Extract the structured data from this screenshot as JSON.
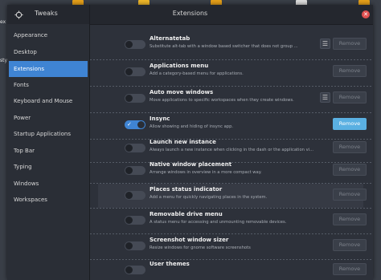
{
  "desktop": {
    "labels": [
      "ex",
      "sty"
    ]
  },
  "window": {
    "app_title": "Tweaks",
    "title": "Extensions",
    "close_glyph": "✕"
  },
  "sidebar": {
    "items": [
      {
        "label": "Appearance",
        "active": false
      },
      {
        "label": "Desktop",
        "active": false
      },
      {
        "label": "Extensions",
        "active": true
      },
      {
        "label": "Fonts",
        "active": false
      },
      {
        "label": "Keyboard and Mouse",
        "active": false
      },
      {
        "label": "Power",
        "active": false
      },
      {
        "label": "Startup Applications",
        "active": false
      },
      {
        "label": "Top Bar",
        "active": false
      },
      {
        "label": "Typing",
        "active": false
      },
      {
        "label": "Windows",
        "active": false
      },
      {
        "label": "Workspaces",
        "active": false
      }
    ]
  },
  "extensions": [
    {
      "title": "Alternatetab",
      "description": "Substitute alt-tab with a window based switcher that does not group ...",
      "enabled": false,
      "has_prefs": true,
      "remove_label": "Remove",
      "remove_active": false
    },
    {
      "title": "Applications menu",
      "description": "Add a category-based menu for applications.",
      "enabled": false,
      "has_prefs": false,
      "remove_label": "Remove",
      "remove_active": false
    },
    {
      "title": "Auto move windows",
      "description": "Move applications to specific workspaces when they create windows.",
      "enabled": false,
      "has_prefs": true,
      "remove_label": "Remove",
      "remove_active": false
    },
    {
      "title": "Insync",
      "description": "Allow showing and hiding of insync app.",
      "enabled": true,
      "has_prefs": false,
      "remove_label": "Remove",
      "remove_active": true
    },
    {
      "title": "Launch new instance",
      "description": "Always launch a new instance when clicking in the dash or the application vi...",
      "enabled": false,
      "has_prefs": false,
      "remove_label": "Remove",
      "remove_active": false
    },
    {
      "title": "Native window placement",
      "description": "Arrange windows in overview in a more compact way.",
      "enabled": false,
      "has_prefs": false,
      "remove_label": "Remove",
      "remove_active": false
    },
    {
      "title": "Places status indicator",
      "description": "Add a menu for quickly navigating places in the system.",
      "enabled": false,
      "has_prefs": false,
      "remove_label": "Remove",
      "remove_active": false,
      "highlighted": true
    },
    {
      "title": "Removable drive menu",
      "description": "A status menu for accessing and unmounting removable devices.",
      "enabled": false,
      "has_prefs": false,
      "remove_label": "Remove",
      "remove_active": false
    },
    {
      "title": "Screenshot window sizer",
      "description": "Resize windows for gnome software screenshots",
      "enabled": false,
      "has_prefs": false,
      "remove_label": "Remove",
      "remove_active": false
    },
    {
      "title": "User themes",
      "description": "",
      "enabled": false,
      "has_prefs": false,
      "remove_label": "Remove",
      "remove_active": false
    }
  ],
  "colors": {
    "accent": "#3f84d3",
    "remove_active": "#5ab0e2",
    "close": "#e05050"
  }
}
